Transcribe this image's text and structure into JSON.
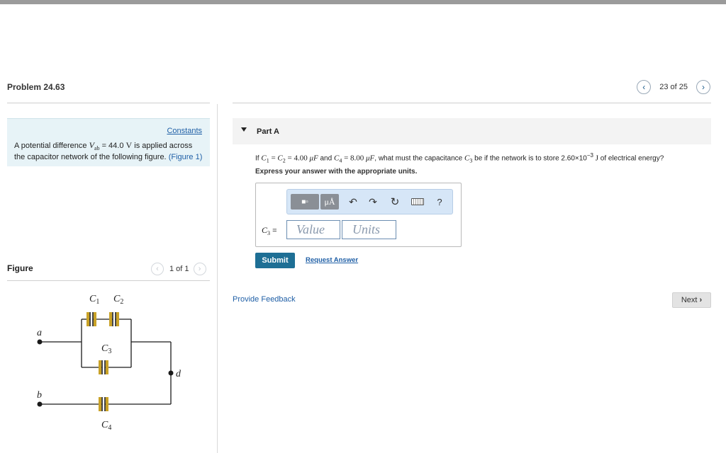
{
  "problem": {
    "title": "Problem 24.63"
  },
  "pager": {
    "text": "23 of 25"
  },
  "constants": {
    "label": "Constants"
  },
  "intro": {
    "pre": "A potential difference ",
    "var": "V",
    "var_sub": "ab",
    "mid": " = 44.0 ",
    "unit": "V",
    "post": " is applied across the capacitor network of the following figure. ",
    "figure_link": "(Figure 1)"
  },
  "figure": {
    "label": "Figure",
    "pager_text": "1 of 1",
    "labels": {
      "c1": "C",
      "c1_sub": "1",
      "c2": "C",
      "c2_sub": "2",
      "c3": "C",
      "c3_sub": "3",
      "c4": "C",
      "c4_sub": "4",
      "a": "a",
      "b": "b",
      "d": "d"
    },
    "colors": {
      "plate": "#c9a227",
      "wire": "#1a1a1a"
    }
  },
  "part": {
    "title": "Part A"
  },
  "question": {
    "if": "If ",
    "eq_a": "C",
    "sub1": "1",
    "eq_eq": " = ",
    "sub2": "2",
    "eq_val1": " = 4.00 ",
    "mu1": "μF",
    "and": " and ",
    "sub4": "4",
    "eq_val2": " = 8.00 ",
    "mu2": "μF",
    "rest": ", what must the capacitance ",
    "sub3": "3",
    "rest2": " be if the network is to store 2.60×10",
    "exp": "−3",
    "unitJ": " J",
    "rest3": " of electrical energy?"
  },
  "instruction": "Express your answer with the appropriate units.",
  "toolbar": {
    "template_icon": "template-icon",
    "mu_label": "μÅ",
    "undo_icon": "undo-icon",
    "redo_icon": "redo-icon",
    "reset_icon": "reset-icon",
    "keyboard_icon": "keyboard-icon",
    "help_label": "?"
  },
  "answer": {
    "label": "C",
    "label_sub": "3",
    "label_eq": " =",
    "value_placeholder": "Value",
    "units_placeholder": "Units"
  },
  "actions": {
    "submit": "Submit",
    "request": "Request Answer",
    "feedback": "Provide Feedback",
    "next": "Next"
  },
  "colors": {
    "accent": "#1e6f95",
    "link": "#1f5fa6",
    "info_bg": "#e7f3f7",
    "toolbar_bg": "#d6e6f7"
  }
}
